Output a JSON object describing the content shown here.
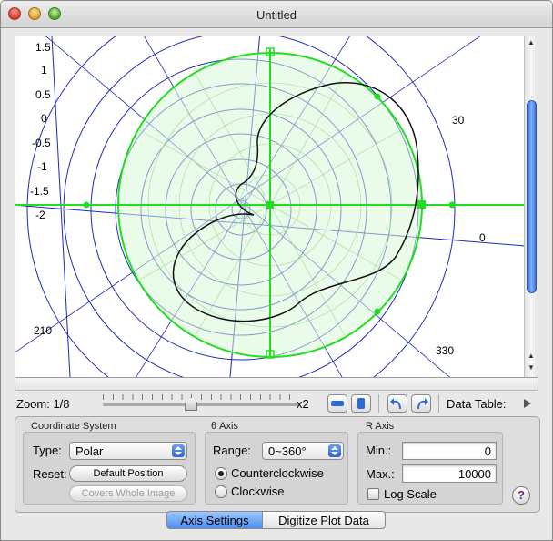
{
  "window": {
    "title": "Untitled"
  },
  "plot": {
    "left_labels": [
      "1.5",
      "1",
      "0.5",
      "0",
      "-0.5",
      "-1",
      "-1.5",
      "-2"
    ],
    "angle_labels": [
      "30",
      "0",
      "210",
      "330"
    ]
  },
  "toolbar": {
    "zoom_label": "Zoom: 1/8",
    "zoom_max_label": "x2",
    "data_table_label": "Data Table:",
    "zoom_level": 0.45
  },
  "coordinate_system": {
    "title": "Coordinate System",
    "type_label": "Type:",
    "type_value": "Polar",
    "reset_label": "Reset:",
    "default_position_button": "Default Position",
    "covers_whole_image_button": "Covers Whole Image"
  },
  "theta_axis": {
    "title": "θ Axis",
    "range_label": "Range:",
    "range_value": "0~360°",
    "counterclockwise_label": "Counterclockwise",
    "clockwise_label": "Clockwise",
    "selected": "counterclockwise"
  },
  "r_axis": {
    "title": "R Axis",
    "min_label": "Min.:",
    "min_value": "0",
    "max_label": "Max.:",
    "max_value": "10000",
    "log_scale_label": "Log Scale",
    "log_scale_checked": false
  },
  "tabs": [
    {
      "label": "Axis Settings",
      "selected": true
    },
    {
      "label": "Digitize Plot Data",
      "selected": false
    }
  ],
  "colors": {
    "accent": "#2c6bd6",
    "grid_blue": "#1d2ab8",
    "overlay_green": "#22dd22",
    "fill_green": "#d8f8d8",
    "curve": "#111111"
  },
  "icons": {
    "help": "?",
    "rotate_left": "rotate-left-icon",
    "rotate_right": "rotate-right-icon"
  }
}
